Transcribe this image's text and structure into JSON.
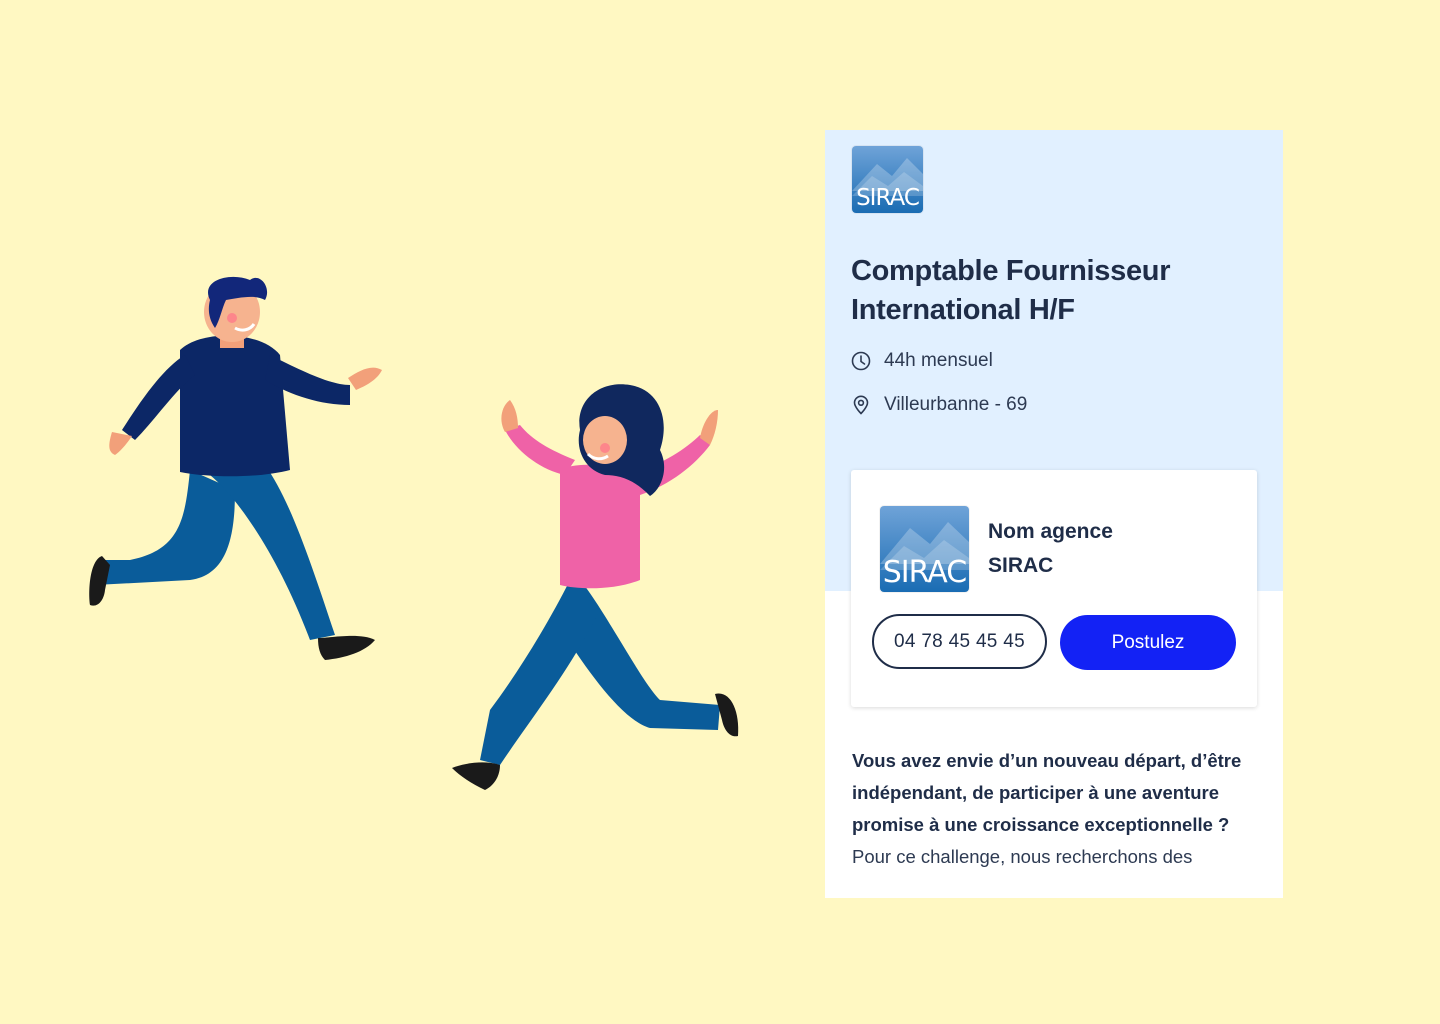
{
  "colors": {
    "background": "#fff8c2",
    "card_top": "#e1f0ff",
    "primary_button": "#1322f5",
    "text": "#1f2d48"
  },
  "job": {
    "logo_text": "SIRAC",
    "title": "Comptable Fournisseur International H/F",
    "hours_icon": "clock-icon",
    "hours": "44h mensuel",
    "location_icon": "location-pin-icon",
    "location": "Villeurbanne - 69"
  },
  "agency": {
    "logo_text": "SIRAC",
    "label": "Nom agence",
    "name": "SIRAC",
    "phone": "04 78 45 45 45",
    "apply_label": "Postulez"
  },
  "description": {
    "lead": "Vous avez envie d’un nouveau départ, d’être indépendant, de participer à une aventure promise à une croissance exceptionnelle ?",
    "body": "Pour ce challenge, nous recherchons des"
  }
}
